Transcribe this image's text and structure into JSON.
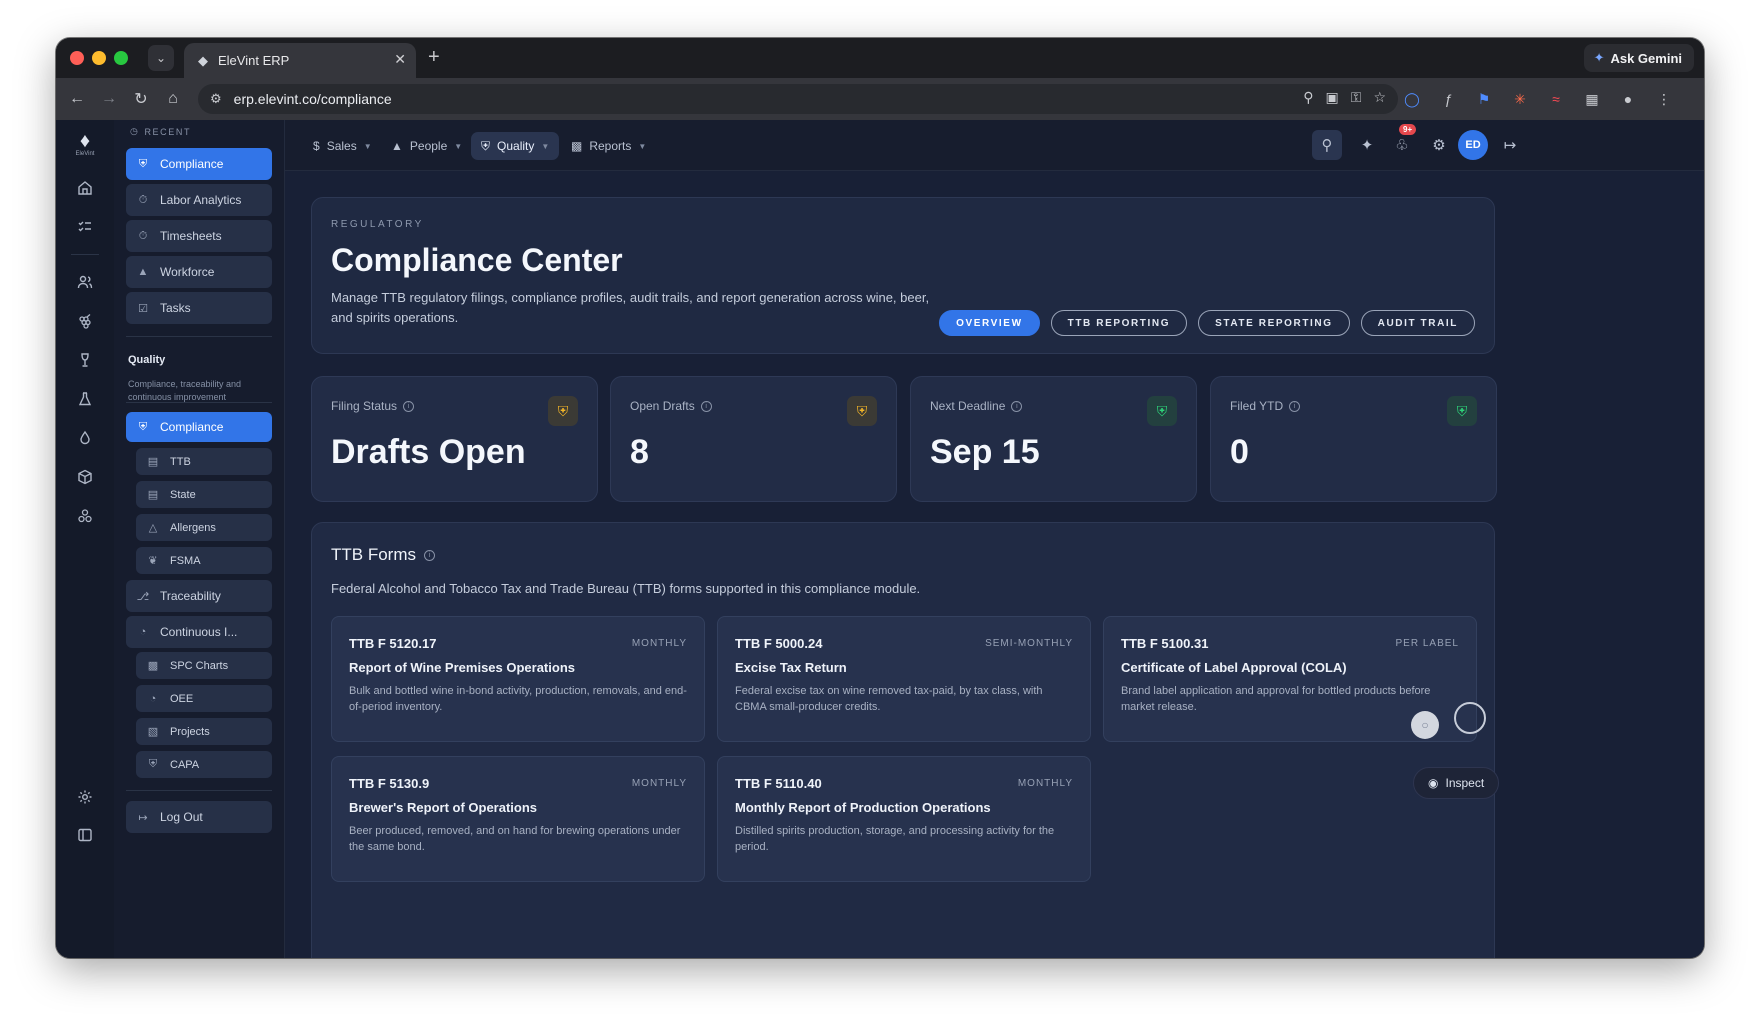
{
  "browser": {
    "tab_title": "EleVint ERP",
    "new_tab": "+",
    "ask_gemini": "Ask Gemini",
    "url": "erp.elevint.co/compliance"
  },
  "rail": {
    "logo_text": "EleVint"
  },
  "subnav": {
    "recent_header": "RECENT",
    "recent_items": [
      {
        "label": "Compliance",
        "icon": "shield-icon",
        "active": true
      },
      {
        "label": "Labor Analytics",
        "icon": "stopwatch-icon"
      },
      {
        "label": "Timesheets",
        "icon": "stopwatch-icon"
      },
      {
        "label": "Workforce",
        "icon": "hardhat-icon"
      },
      {
        "label": "Tasks",
        "icon": "checkbox-icon"
      }
    ],
    "section_title": "Quality",
    "section_subtitle": "Compliance, traceability and continuous improvement",
    "quality_items": [
      {
        "label": "Compliance",
        "icon": "shield-icon",
        "active": true
      },
      {
        "label": "TTB",
        "icon": "document-icon",
        "sub": true
      },
      {
        "label": "State",
        "icon": "document-icon",
        "sub": true
      },
      {
        "label": "Allergens",
        "icon": "warning-icon",
        "sub": true
      },
      {
        "label": "FSMA",
        "icon": "leaf-icon",
        "sub": true
      },
      {
        "label": "Traceability",
        "icon": "branch-icon"
      },
      {
        "label": "Continuous I...",
        "icon": "gauge-icon"
      },
      {
        "label": "SPC Charts",
        "icon": "bar-chart-icon",
        "sub": true
      },
      {
        "label": "OEE",
        "icon": "gauge-icon",
        "sub": true
      },
      {
        "label": "Projects",
        "icon": "clipboard-icon",
        "sub": true
      },
      {
        "label": "CAPA",
        "icon": "shield-icon",
        "sub": true
      }
    ],
    "logout": "Log Out"
  },
  "topnav": {
    "items": [
      {
        "label": "Sales",
        "icon": "dollar-icon"
      },
      {
        "label": "People",
        "icon": "hardhat-icon"
      },
      {
        "label": "Quality",
        "icon": "shield-icon",
        "active": true
      },
      {
        "label": "Reports",
        "icon": "bar-chart-icon"
      }
    ],
    "notifications_badge": "9+",
    "avatar_initials": "ED"
  },
  "hero": {
    "eyebrow": "REGULATORY",
    "title": "Compliance Center",
    "description": "Manage TTB regulatory filings, compliance profiles, audit trails, and report generation across wine, beer, and spirits operations.",
    "tabs": [
      {
        "label": "OVERVIEW",
        "active": true
      },
      {
        "label": "TTB REPORTING"
      },
      {
        "label": "STATE REPORTING"
      },
      {
        "label": "AUDIT TRAIL"
      }
    ]
  },
  "stats": [
    {
      "label": "Filing Status",
      "value": "Drafts Open",
      "status": "warning",
      "status_color": "#f0b429"
    },
    {
      "label": "Open Drafts",
      "value": "8",
      "status": "warning",
      "status_color": "#f0b429"
    },
    {
      "label": "Next Deadline",
      "value": "Sep 15",
      "status": "ok",
      "status_color": "#2ed37a"
    },
    {
      "label": "Filed YTD",
      "value": "0",
      "status": "ok",
      "status_color": "#2ed37a"
    }
  ],
  "forms": {
    "title": "TTB Forms",
    "description": "Federal Alcohol and Tobacco Tax and Trade Bureau (TTB) forms supported in this compliance module.",
    "cards": [
      {
        "code": "TTB F 5120.17",
        "frequency": "MONTHLY",
        "name": "Report of Wine Premises Operations",
        "description": "Bulk and bottled wine in-bond activity, production, removals, and end-of-period inventory."
      },
      {
        "code": "TTB F 5000.24",
        "frequency": "SEMI-MONTHLY",
        "name": "Excise Tax Return",
        "description": "Federal excise tax on wine removed tax-paid, by tax class, with CBMA small-producer credits."
      },
      {
        "code": "TTB F 5100.31",
        "frequency": "PER LABEL",
        "name": "Certificate of Label Approval (COLA)",
        "description": "Brand label application and approval for bottled products before market release."
      },
      {
        "code": "TTB F 5130.9",
        "frequency": "MONTHLY",
        "name": "Brewer's Report of Operations",
        "description": "Beer produced, removed, and on hand for brewing operations under the same bond."
      },
      {
        "code": "TTB F 5110.40",
        "frequency": "MONTHLY",
        "name": "Monthly Report of Production Operations",
        "description": "Distilled spirits production, storage, and processing activity for the period."
      }
    ]
  },
  "floating": {
    "inspect": "Inspect"
  },
  "colors": {
    "accent": "#3275e8",
    "warning": "#f0b429",
    "success": "#2ed37a",
    "badge": "#e5484d"
  }
}
